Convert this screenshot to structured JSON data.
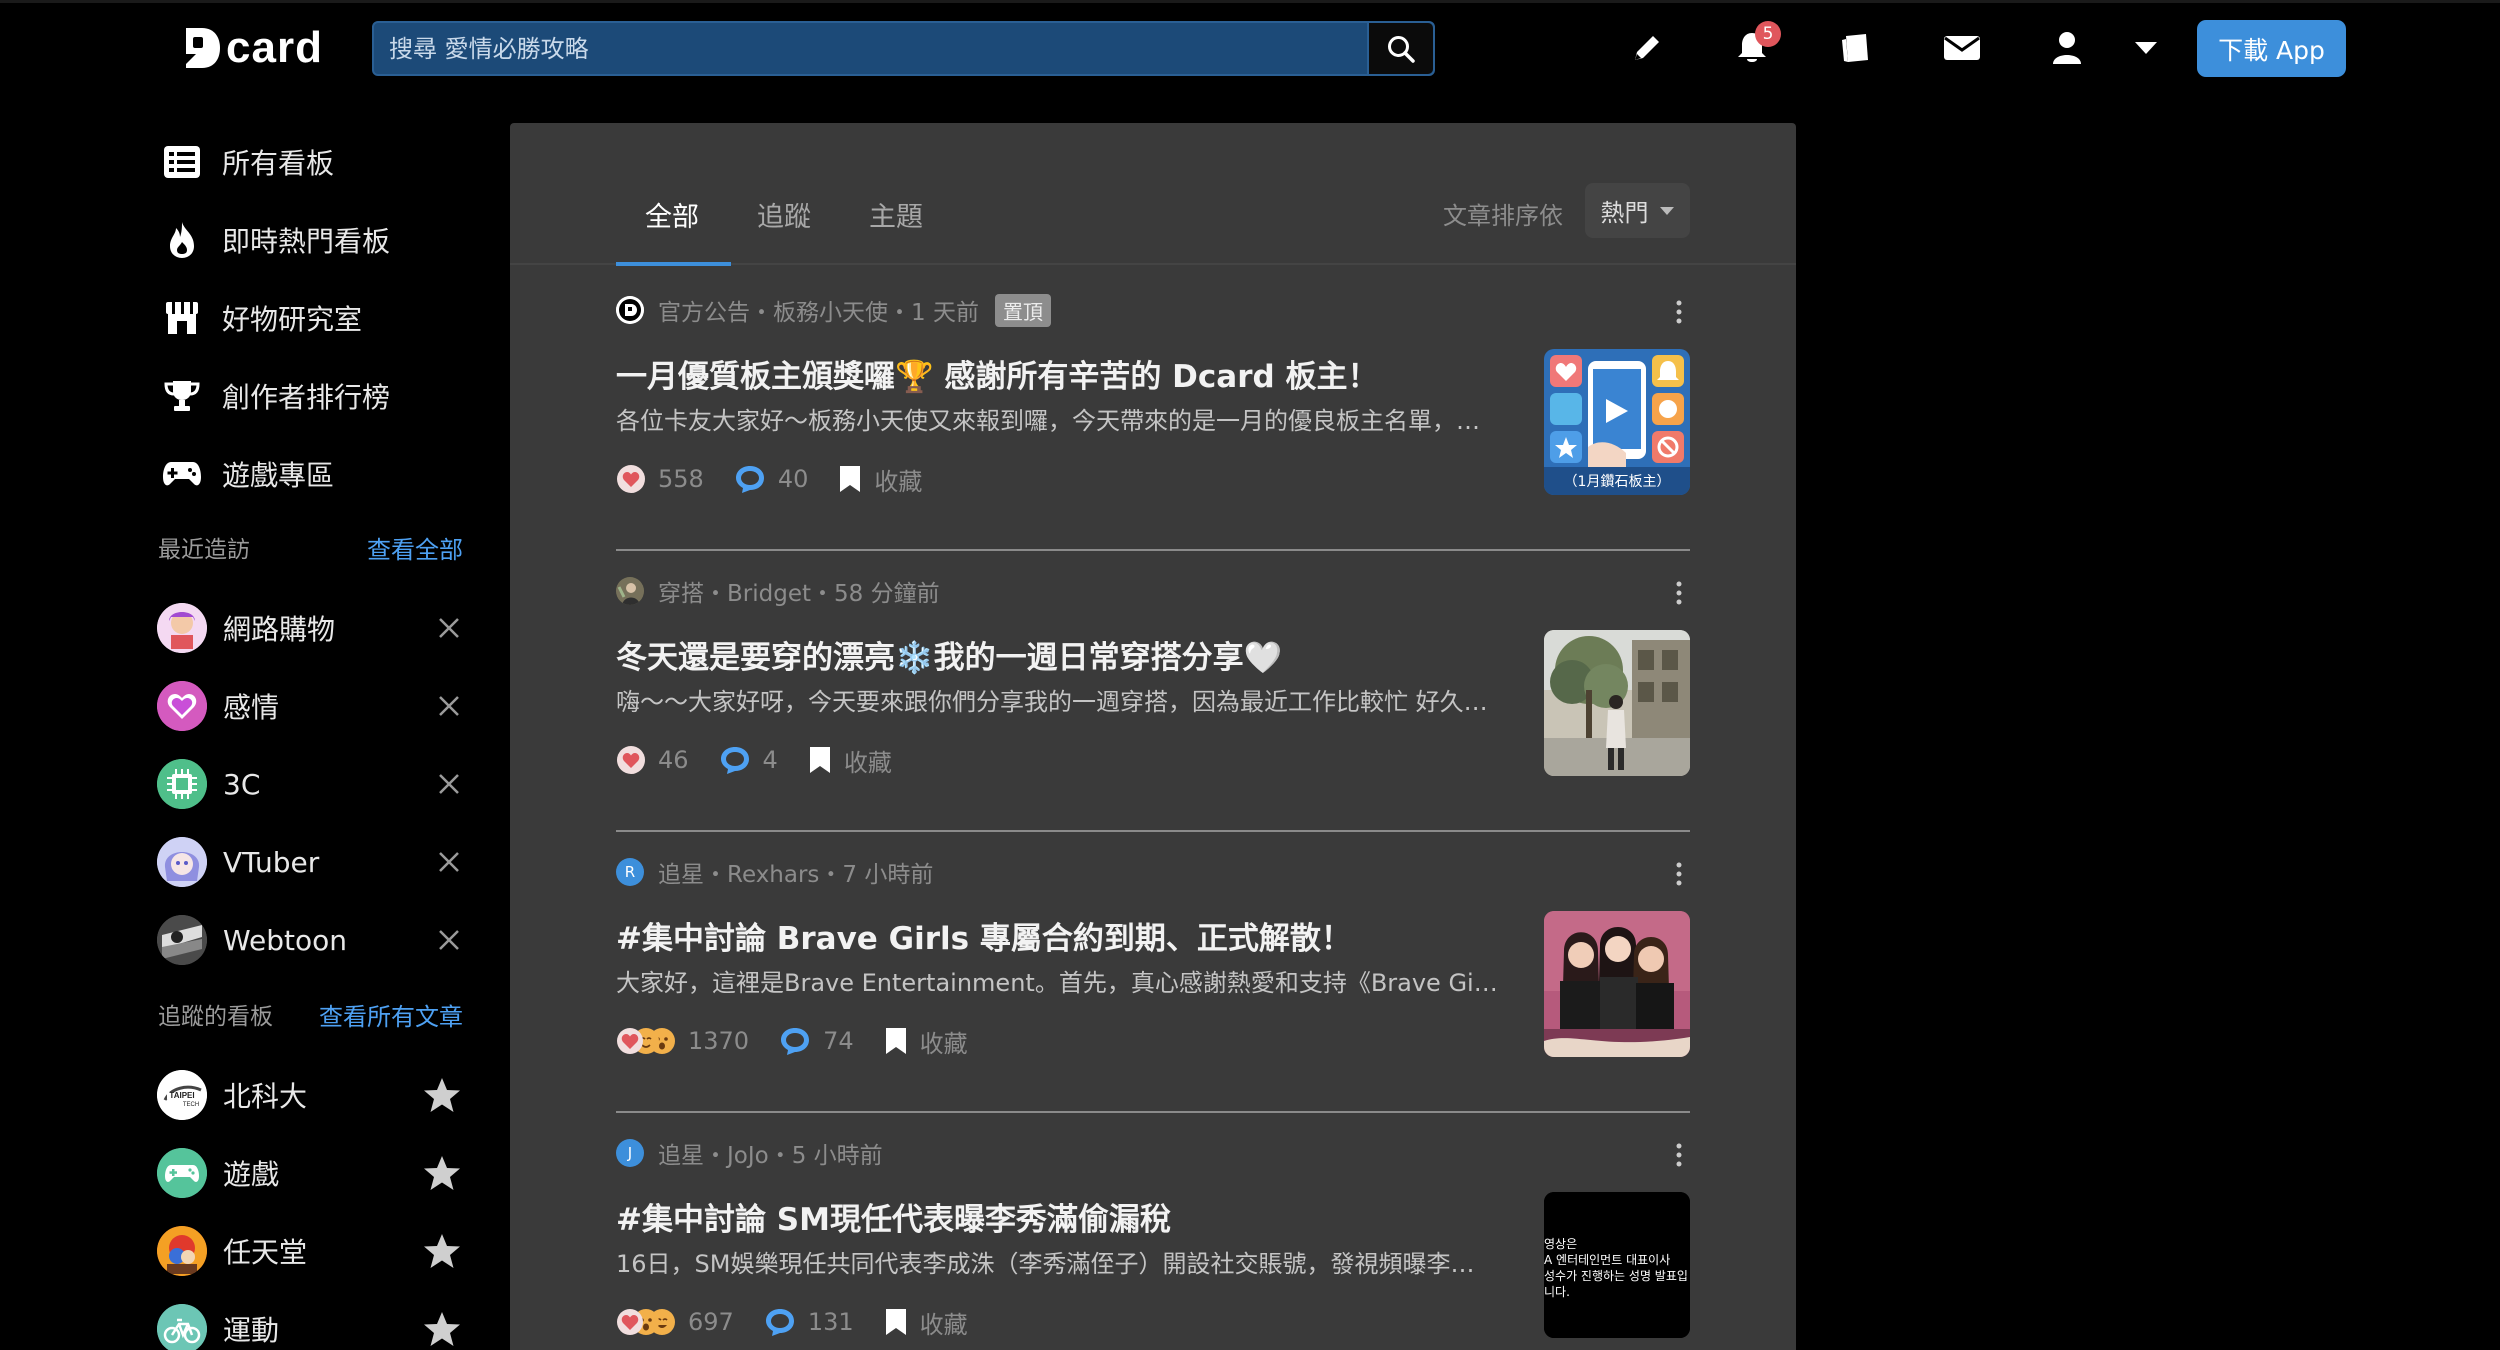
{
  "header": {
    "logo_text": "card",
    "search": {
      "placeholder": "搜尋 愛情必勝攻略"
    },
    "notification_count": "5",
    "download_label": "下載 App"
  },
  "sidebar": {
    "nav": [
      {
        "label": "所有看板",
        "icon": "list-icon"
      },
      {
        "label": "即時熱門看板",
        "icon": "fire-icon"
      },
      {
        "label": "好物研究室",
        "icon": "store-icon"
      },
      {
        "label": "創作者排行榜",
        "icon": "trophy-icon"
      },
      {
        "label": "遊戲專區",
        "icon": "gamepad-icon"
      }
    ],
    "recent": {
      "title": "最近造訪",
      "link": "查看全部",
      "items": [
        {
          "label": "網路購物"
        },
        {
          "label": "感情"
        },
        {
          "label": "3C"
        },
        {
          "label": "VTuber"
        },
        {
          "label": "Webtoon"
        }
      ]
    },
    "following": {
      "title": "追蹤的看板",
      "link": "查看所有文章",
      "items": [
        {
          "label": "北科大"
        },
        {
          "label": "遊戲"
        },
        {
          "label": "任天堂"
        },
        {
          "label": "運動"
        }
      ]
    }
  },
  "main": {
    "tabs": [
      {
        "label": "全部",
        "active": true
      },
      {
        "label": "追蹤",
        "active": false
      },
      {
        "label": "主題",
        "active": false
      }
    ],
    "sort_label": "文章排序依",
    "sort_value": "熱門",
    "posts": [
      {
        "meta": "官方公告・板務小天使・1 天前",
        "tag": "置頂",
        "title": "一月優質板主頒獎囉🏆 感謝所有辛苦的 Dcard 板主！",
        "excerpt": "各位卡友大家好～板務小天使又來報到囉，今天帶來的是一月的優良板主名單，…",
        "likes": "558",
        "comments": "40",
        "save": "收藏",
        "thumb_caption": "（1月鑽石板主）"
      },
      {
        "meta": "穿搭・Bridget・58 分鐘前",
        "title": "冬天還是要穿的漂亮❄️我的一週日常穿搭分享🤍",
        "excerpt": "嗨～～大家好呀，今天要來跟你們分享我的一週穿搭，因為最近工作比較忙 好久…",
        "likes": "46",
        "comments": "4",
        "save": "收藏"
      },
      {
        "meta": "追星・Rexhars・7 小時前",
        "avatar_letter": "R",
        "title": "#集中討論 Brave Girls 專屬合約到期、正式解散！",
        "excerpt": "大家好，這裡是Brave Entertainment。首先，真心感謝熱愛和支持《Brave Girls…",
        "likes": "1370",
        "comments": "74",
        "save": "收藏"
      },
      {
        "meta": "追星・JoJo・5 小時前",
        "avatar_letter": "J",
        "title": "#集中討論 SM現任代表曝李秀滿偷漏稅",
        "excerpt": "16日，SM娛樂現任共同代表李成洙（李秀滿侄子）開設社交賬號，發視頻曝李…",
        "likes": "697",
        "comments": "131",
        "save": "收藏",
        "thumb_text": [
          "영상은",
          "A 엔터테인먼트 대표이사",
          "성수가 진행하는 성명 발표입",
          "니다."
        ]
      }
    ]
  },
  "colors": {
    "accent": "#3d8fdb",
    "panel": "#3a3a3a",
    "heart": "#e0565c",
    "comment": "#4ea1f3",
    "badge": "#e0565c"
  }
}
